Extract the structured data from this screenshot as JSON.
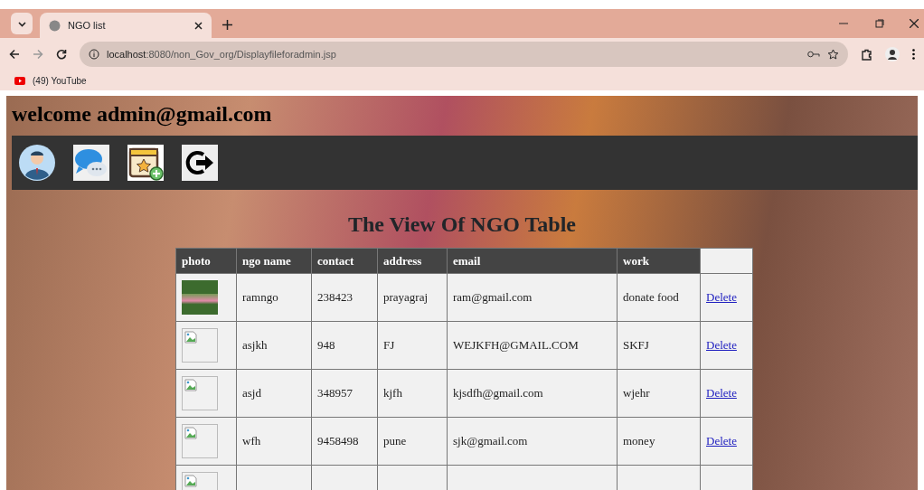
{
  "browser": {
    "tab_title": "NGO list",
    "url_host": "localhost",
    "url_rest": ":8080/non_Gov_org/Displayfileforadmin.jsp",
    "bookmarks": [
      {
        "label": "(49) YouTube"
      }
    ]
  },
  "page": {
    "welcome": "welcome admin@gmail.com",
    "nav_icons": [
      {
        "kind": "profile"
      },
      {
        "kind": "chat"
      },
      {
        "kind": "calendar"
      },
      {
        "kind": "logout"
      }
    ],
    "heading": "The View Of NGO Table"
  },
  "table": {
    "columns": [
      "photo",
      "ngo name",
      "contact",
      "address",
      "email",
      "work"
    ],
    "rows": [
      {
        "kind": "image",
        "cells": [
          "ramngo",
          "238423",
          "prayagraj",
          "ram@gmail.com",
          "donate food"
        ],
        "action": "Delete"
      },
      {
        "kind": "broken",
        "cells": [
          "asjkh",
          "948",
          "FJ",
          "WEJKFH@GMAIL.COM",
          "SKFJ"
        ],
        "action": "Delete"
      },
      {
        "kind": "broken",
        "cells": [
          "asjd",
          "348957",
          "kjfh",
          "kjsdfh@gmail.com",
          "wjehr"
        ],
        "action": "Delete"
      },
      {
        "kind": "broken",
        "cells": [
          "wfh",
          "9458498",
          "pune",
          "sjk@gmail.com",
          "money"
        ],
        "action": "Delete"
      },
      {
        "kind": "broken"
      }
    ]
  }
}
